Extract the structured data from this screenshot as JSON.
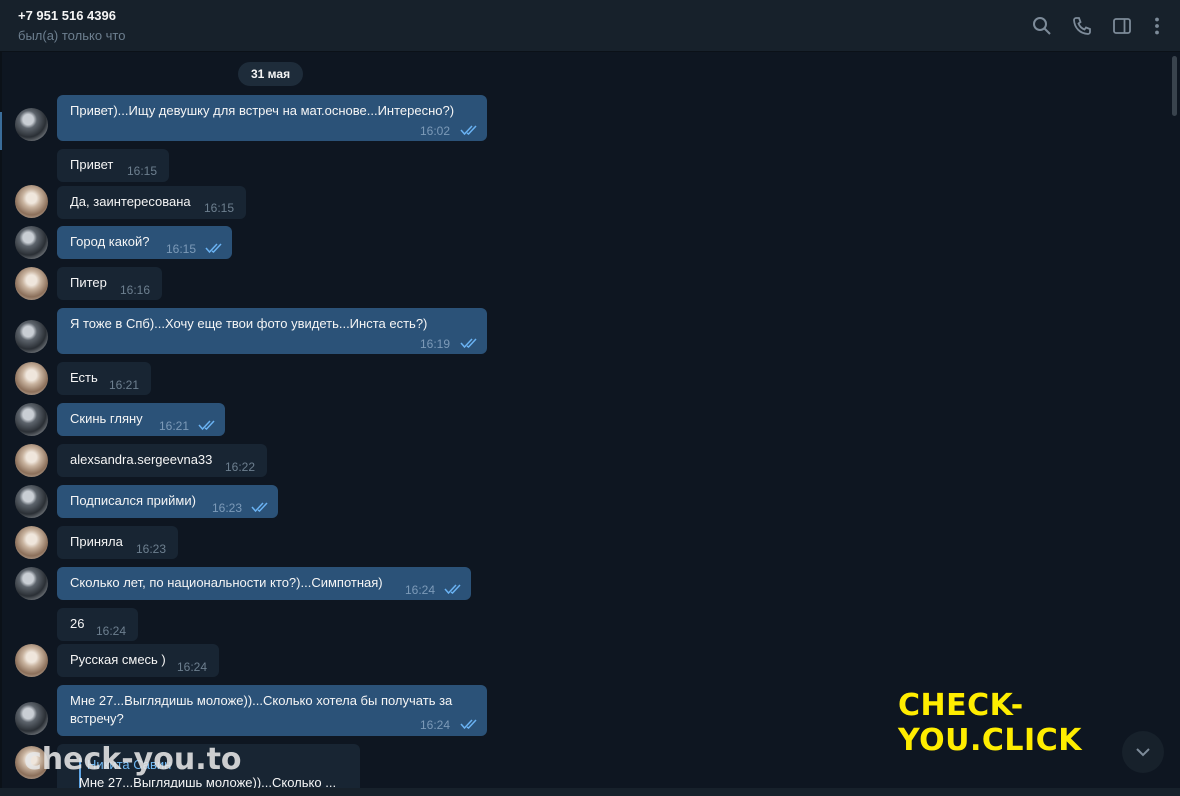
{
  "header": {
    "title": "+7 951 516 4396",
    "status": "был(а) только что",
    "icons": [
      "search-icon",
      "phone-icon",
      "sidebar-toggle-icon",
      "more-vert-icon"
    ]
  },
  "chat": {
    "date": "31 мая",
    "messages": [
      {
        "dir": "out",
        "text": "Привет)...Ищу девушку для встреч на мат.основе...Интересно?)",
        "time": "16:02",
        "read": true
      },
      {
        "dir": "in",
        "text": "Привет",
        "time": "16:15"
      },
      {
        "dir": "in",
        "text": "Да, заинтересована",
        "time": "16:15"
      },
      {
        "dir": "out",
        "text": "Город какой?",
        "time": "16:15",
        "read": true
      },
      {
        "dir": "in",
        "text": "Питер",
        "time": "16:16"
      },
      {
        "dir": "out",
        "text": "Я тоже в Спб)...Хочу еще твои фото увидеть...Инста есть?)",
        "time": "16:19",
        "read": true
      },
      {
        "dir": "in",
        "text": "Есть",
        "time": "16:21"
      },
      {
        "dir": "out",
        "text": "Скинь гляну",
        "time": "16:21",
        "read": true
      },
      {
        "dir": "in",
        "text": "alexsandra.sergeevna33",
        "time": "16:22"
      },
      {
        "dir": "out",
        "text": "Подписался прийми)",
        "time": "16:23",
        "read": true
      },
      {
        "dir": "in",
        "text": "Приняла",
        "time": "16:23"
      },
      {
        "dir": "out",
        "text": "Сколько лет, по национальности кто?)...Симпотная)",
        "time": "16:24",
        "read": true
      },
      {
        "dir": "in",
        "text": "26",
        "time": "16:24"
      },
      {
        "dir": "in",
        "text": "Русская смесь )",
        "time": "16:24"
      },
      {
        "dir": "out",
        "text": "Мне 27...Выглядишь моложе))...Сколько хотела бы получать за встречу?",
        "time": "16:24",
        "read": true
      }
    ],
    "reply": {
      "name": "Никита Савин",
      "quoted": "Мне 27...Выглядишь моложе))...Сколько ..."
    }
  },
  "watermarks": {
    "right": "CHECK-YOU.CLICK",
    "left": "check-you.to"
  },
  "colors": {
    "background": "#0e1621",
    "header": "#17212b",
    "bubble_out": "#2b5278",
    "bubble_in": "#182533",
    "watermark_yellow": "#ffed00"
  }
}
